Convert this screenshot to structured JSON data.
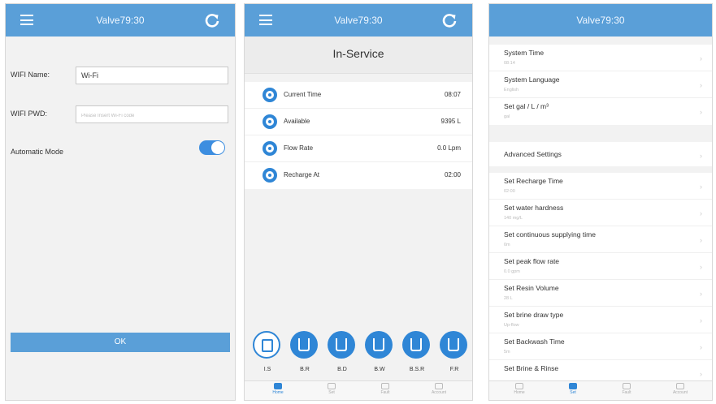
{
  "app_title": "Valve79:30",
  "wifi_panel": {
    "name_label": "WIFI Name:",
    "name_value": "Wi-Fi",
    "pwd_label": "WIFI PWD:",
    "pwd_placeholder": "Please Insert Wi-Fi code",
    "auto_label": "Automatic Mode",
    "auto_on": true,
    "ok_label": "OK"
  },
  "status_panel": {
    "status_title": "In-Service",
    "rows": [
      {
        "label": "Current Time",
        "value": "08:07",
        "icon": "clock-icon"
      },
      {
        "label": "Available",
        "value": "9395 L",
        "icon": "water-tank-icon"
      },
      {
        "label": "Flow Rate",
        "value": "0.0 Lpm",
        "icon": "flow-icon"
      },
      {
        "label": "Recharge At",
        "value": "02:00",
        "icon": "recharge-icon"
      }
    ],
    "modes": [
      {
        "label": "I.S",
        "active": true
      },
      {
        "label": "B.R",
        "active": false
      },
      {
        "label": "B.D",
        "active": false
      },
      {
        "label": "B.W",
        "active": false
      },
      {
        "label": "B.S.R",
        "active": false
      },
      {
        "label": "F.R",
        "active": false
      }
    ]
  },
  "tabs": [
    "Home",
    "Set",
    "Fault",
    "Account"
  ],
  "settings_panel": {
    "group1": [
      {
        "title": "System Time",
        "value": "08:14"
      },
      {
        "title": "System Language",
        "value": "English"
      },
      {
        "title": "Set gal / L / m³",
        "value": "gal"
      }
    ],
    "advanced": "Advanced Settings",
    "group2": [
      {
        "title": "Set Recharge Time",
        "value": "02:00"
      },
      {
        "title": "Set water hardness",
        "value": "140 mg/L"
      },
      {
        "title": "Set continuous supplying time",
        "value": "0m"
      },
      {
        "title": "Set peak flow rate",
        "value": "0.0 gpm"
      },
      {
        "title": "Set Resin Volume",
        "value": "28 L"
      },
      {
        "title": "Set brine draw type",
        "value": "Up-flow"
      },
      {
        "title": "Set Backwash Time",
        "value": "5m"
      },
      {
        "title": "Set Brine & Rinse",
        "value": ""
      }
    ]
  },
  "colors": {
    "header": "#5a9fd8",
    "accent": "#2f86d6"
  }
}
